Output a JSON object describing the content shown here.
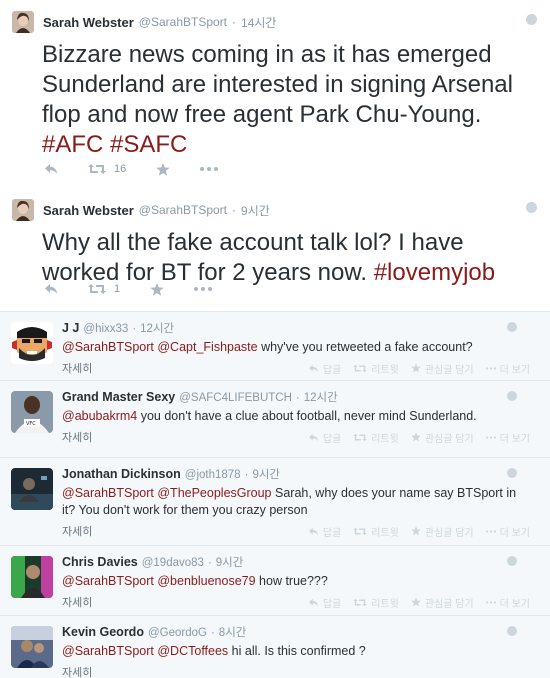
{
  "main_tweets": [
    {
      "name": "Sarah Webster",
      "handle": "@SarahBTSport",
      "time": "14시간",
      "text_before": "Bizzare news coming in as it has emerged Sunderland are interested in signing Arsenal flop and now free agent Park Chu-Young. ",
      "hashtags": "#AFC #SAFC",
      "retweet_count": "16"
    },
    {
      "name": "Sarah Webster",
      "handle": "@SarahBTSport",
      "time": "9시간",
      "text_before": "Why all the fake account talk lol? I have worked for BT for 2 years now. ",
      "hashtags": "#lovemyjob",
      "retweet_count": "1"
    }
  ],
  "reply_actions": {
    "reply": "답글",
    "retweet": "리트윗",
    "favorite": "관심글 담기",
    "more": "더 보기",
    "expand": "자세히"
  },
  "replies": [
    {
      "name": "J J",
      "handle": "@hixx33",
      "time": "12시간",
      "mentions": "@SarahBTSport @Capt_Fishpaste",
      "text": " why've you retweeted a fake account?"
    },
    {
      "name": "Grand Master Sexy",
      "handle": "@SAFC4LIFEBUTCH",
      "time": "12시간",
      "mentions": "@abubakrm4",
      "text": " you don't have a clue about football, never mind Sunderland."
    },
    {
      "name": "Jonathan Dickinson",
      "handle": "@joth1878",
      "time": "9시간",
      "mentions": "@SarahBTSport @ThePeoplesGroup",
      "text": " Sarah, why does your name say BTSport in it? You don't work for them you crazy person"
    },
    {
      "name": "Chris Davies",
      "handle": "@19davo83",
      "time": "9시간",
      "mentions": "@SarahBTSport @benbluenose79",
      "text": " how true???"
    },
    {
      "name": "Kevin Geordo",
      "handle": "@GeordoG",
      "time": "8시간",
      "mentions": "@SarahBTSport @DCToffees",
      "text": " hi all. Is this confirmed ?"
    }
  ],
  "colors": {
    "hashtag": "#8b1a1a",
    "meta": "#8899a6",
    "reply_bg": "#f5f8fa"
  }
}
